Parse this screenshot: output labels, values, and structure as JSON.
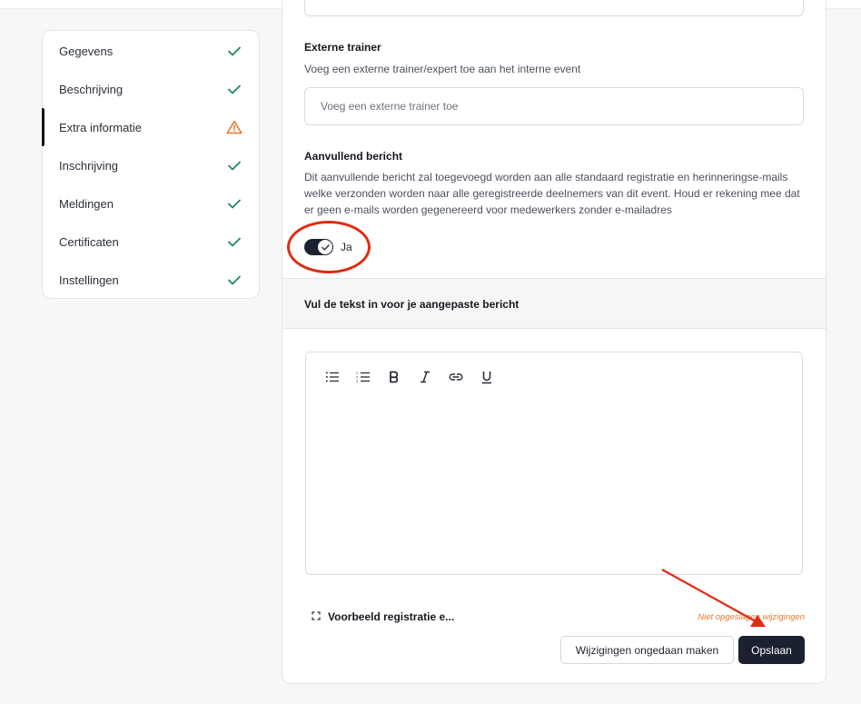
{
  "sidebar": {
    "items": [
      {
        "label": "Gegevens",
        "status": "check-icon"
      },
      {
        "label": "Beschrijving",
        "status": "check-icon"
      },
      {
        "label": "Extra informatie",
        "status": "warning-icon",
        "active": true
      },
      {
        "label": "Inschrijving",
        "status": "check-icon"
      },
      {
        "label": "Meldingen",
        "status": "check-icon"
      },
      {
        "label": "Certificaten",
        "status": "check-icon"
      },
      {
        "label": "Instellingen",
        "status": "check-icon"
      }
    ]
  },
  "external_trainer": {
    "label": "Externe trainer",
    "description": "Voeg een externe trainer/expert toe aan het interne event",
    "placeholder": "Voeg een externe trainer toe",
    "value": ""
  },
  "additional_message": {
    "label": "Aanvullend bericht",
    "description": "Dit aanvullende bericht zal toegevoegd worden aan alle standaard registratie en herinneringse-mails welke verzonden worden naar alle geregistreerde deelnemers van dit event. Houd er rekening mee dat er geen e-mails worden gegenereerd voor medewerkers zonder e-mailadres",
    "toggle_label": "Ja",
    "toggle_on": true
  },
  "custom_message_section": {
    "title": "Vul de tekst in voor je aangepaste bericht"
  },
  "editor": {
    "toolbar": [
      "bullet-list-icon",
      "numbered-list-icon",
      "bold-icon",
      "italic-icon",
      "link-icon",
      "underline-icon"
    ],
    "content": ""
  },
  "footer": {
    "preview_label": "Voorbeeld registratie e...",
    "unsaved_text": "Niet opgeslagen wijzigingen",
    "undo_label": "Wijzigingen ongedaan maken",
    "save_label": "Opslaan"
  },
  "colors": {
    "check": "#1f8a5e",
    "warning": "#e8792a",
    "primary": "#1b2130",
    "annotation": "#e02b12"
  }
}
